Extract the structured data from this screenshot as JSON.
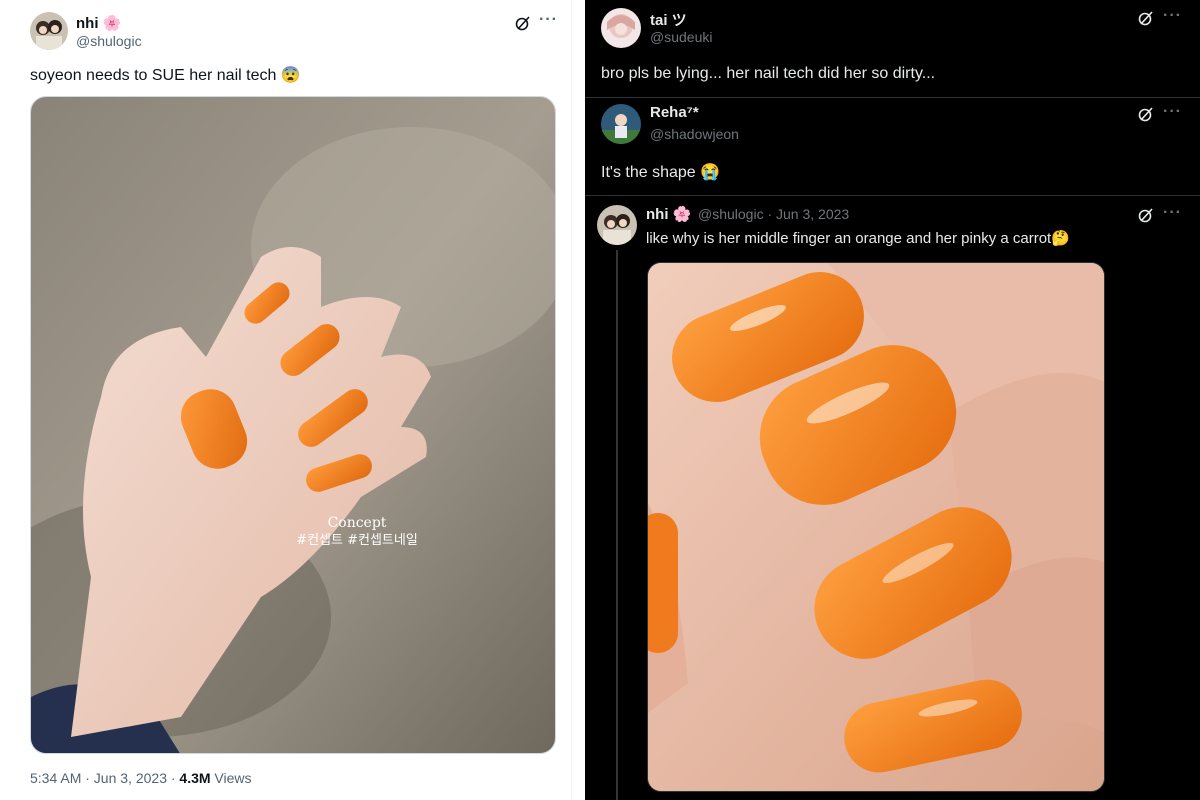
{
  "left_tweet": {
    "display_name": "nhi",
    "name_emoji": "🌸",
    "handle": "@shulogic",
    "text": "soyeon needs to SUE her nail tech 😨",
    "media_caption_line1": "Concept",
    "media_caption_line2": "#컨셉트 #컨셉트네일",
    "time": "5:34 AM · Jun 3, 2023 · ",
    "views_count": "4.3M",
    "views_label": " Views"
  },
  "thread": [
    {
      "display_name": "tai ツ",
      "handle": "@sudeuki",
      "text": "bro pls be lying... her nail tech did her so dirty..."
    },
    {
      "display_name": "Reha⁷*",
      "handle": "@shadowjeon",
      "text": "It's the shape 😭"
    },
    {
      "display_name": "nhi 🌸",
      "handle_date": "@shulogic · Jun 3, 2023",
      "text": "like why is her middle finger an orange and her pinky a carrot🤔"
    }
  ],
  "icons": {
    "grok": "grok-icon",
    "more": "more-icon",
    "avatar": "avatar-icon"
  },
  "colors": {
    "nail_orange": "#f47a1c",
    "dark_bg": "#000000",
    "light_bg": "#ffffff"
  },
  "more_glyph": "···"
}
